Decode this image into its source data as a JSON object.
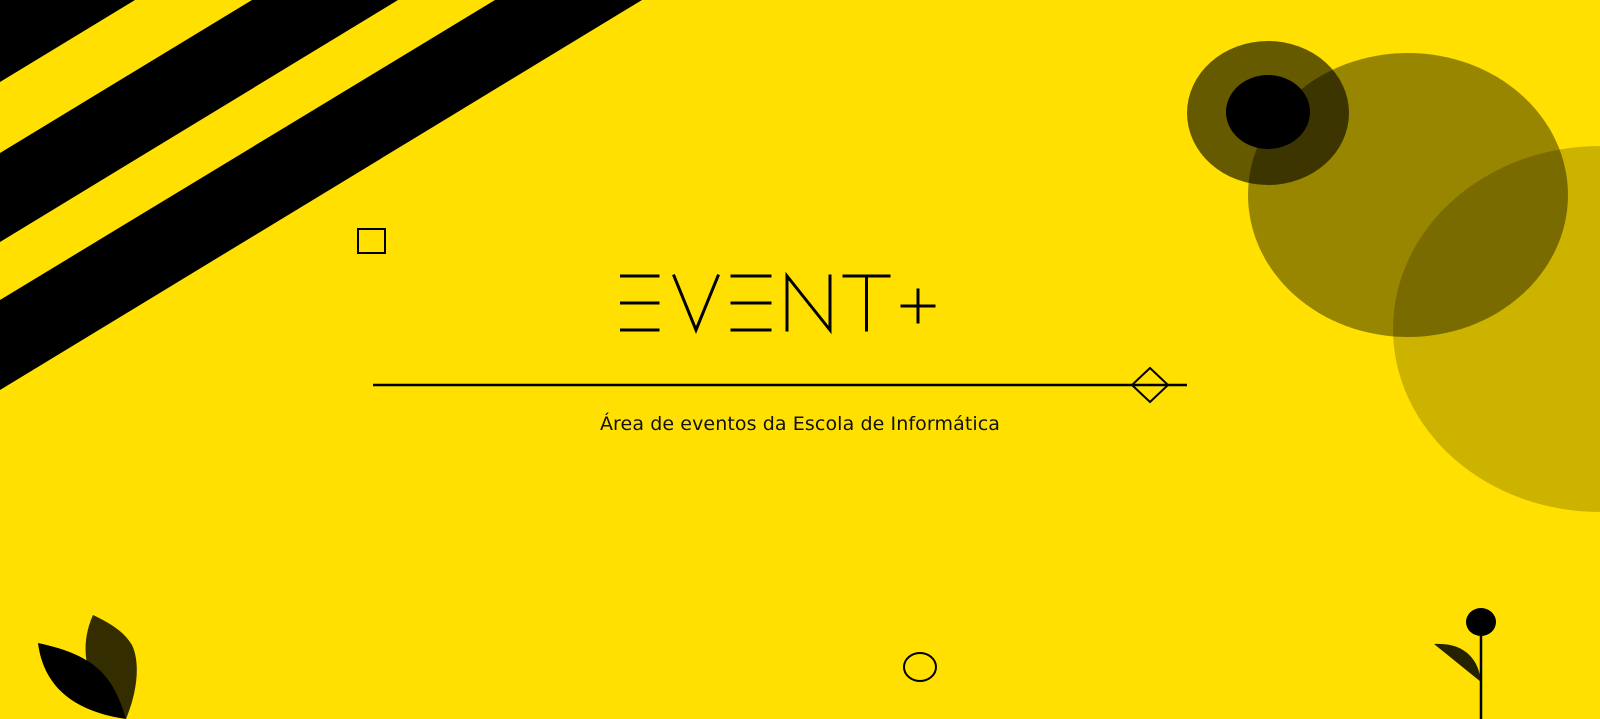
{
  "hero": {
    "logo_text": "EVENT+",
    "tagline": "Área de eventos da Escola de Informática"
  },
  "colors": {
    "background": "#FFE000",
    "ink": "#000000",
    "bottom_strip": "#FFFFFF"
  },
  "decorations": [
    "diagonal-stripes",
    "square-outline",
    "circle-outline",
    "diamond-outline",
    "translucent-circles",
    "leaf-cluster",
    "flower-stem"
  ]
}
